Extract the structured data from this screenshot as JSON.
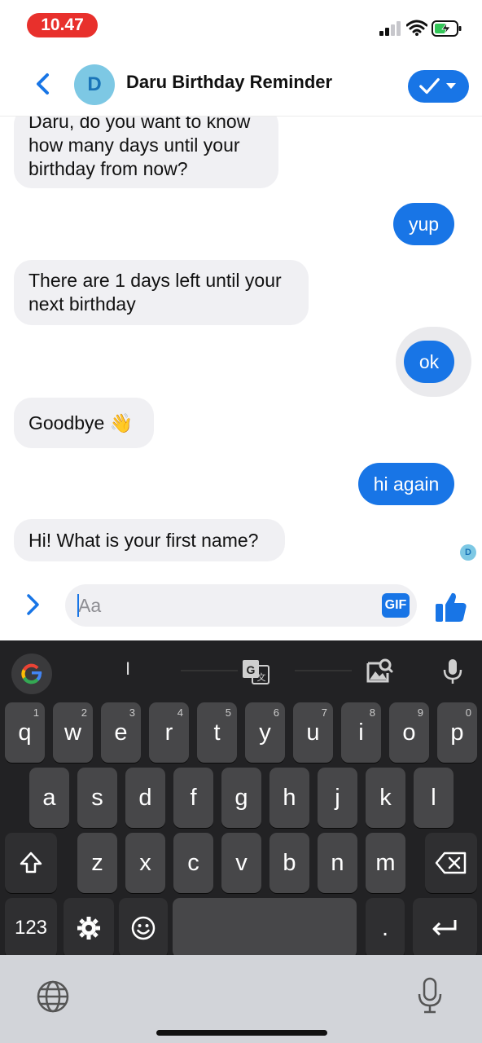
{
  "status_bar": {
    "time": "10.47"
  },
  "header": {
    "avatar_initial": "D",
    "title": "Daru Birthday Reminder"
  },
  "messages": [
    {
      "side": "in",
      "text": "Daru, do you want to know\nhow many days until your\nbirthday from now?"
    },
    {
      "side": "out",
      "text": "yup"
    },
    {
      "side": "in",
      "text": "There are 1 days left until your\nnext birthday"
    },
    {
      "side": "out",
      "text": "ok"
    },
    {
      "side": "in",
      "text": "Goodbye 👋"
    },
    {
      "side": "out",
      "text": "hi again"
    },
    {
      "side": "in",
      "text": "Hi! What is your first name?"
    }
  ],
  "seen_avatar": "D",
  "composer": {
    "placeholder": "Aa",
    "gif_label": "GIF"
  },
  "keyboard": {
    "suggestion": "I",
    "row1": [
      {
        "k": "q",
        "h": "1"
      },
      {
        "k": "w",
        "h": "2"
      },
      {
        "k": "e",
        "h": "3"
      },
      {
        "k": "r",
        "h": "4"
      },
      {
        "k": "t",
        "h": "5"
      },
      {
        "k": "y",
        "h": "6"
      },
      {
        "k": "u",
        "h": "7"
      },
      {
        "k": "i",
        "h": "8"
      },
      {
        "k": "o",
        "h": "9"
      },
      {
        "k": "p",
        "h": "0"
      }
    ],
    "row2": [
      "a",
      "s",
      "d",
      "f",
      "g",
      "h",
      "j",
      "k",
      "l"
    ],
    "row3": [
      "z",
      "x",
      "c",
      "v",
      "b",
      "n",
      "m"
    ],
    "numbers_label": "123",
    "period": "."
  }
}
